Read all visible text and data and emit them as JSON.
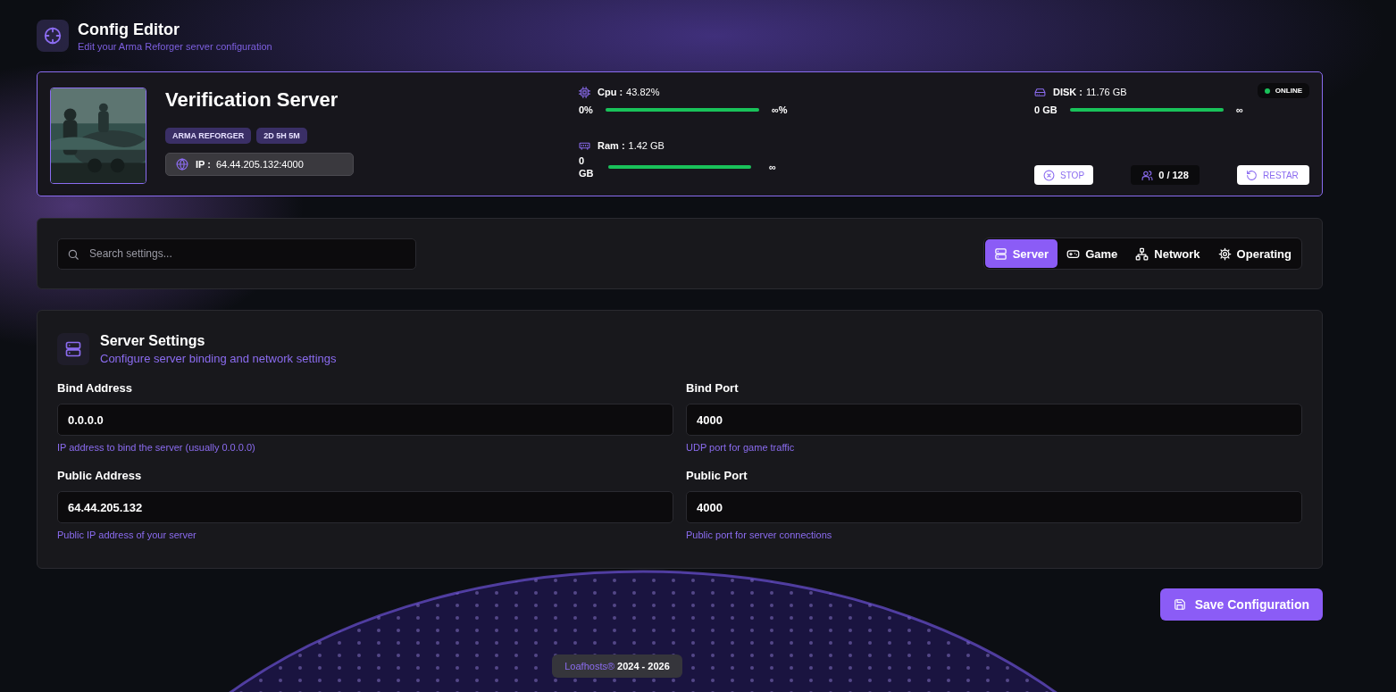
{
  "header": {
    "title": "Config Editor",
    "subtitle": "Edit your Arma Reforger server configuration"
  },
  "server": {
    "image": {
      "kind": "picture"
    },
    "name": "Verification Server",
    "badges": [
      "ARMA REFORGER",
      "2D 5H 5M"
    ],
    "ip_label": "IP :",
    "ip": "64.44.205.132:4000",
    "metrics": [
      {
        "kind": "cpu",
        "label": "Cpu :",
        "value": "43.82%",
        "min": "0%",
        "max": "∞%",
        "level": 1
      },
      {
        "kind": "ram",
        "label": "Ram :",
        "value": "1.42 GB",
        "min": "0 GB",
        "max": "∞",
        "level": 1
      },
      {
        "kind": "disk",
        "label": "DISK :",
        "value": "11.76 GB",
        "min": "0 GB",
        "max": "∞",
        "level": 1
      }
    ],
    "status": {
      "label": "ONLINE",
      "online": true
    },
    "actions": [
      {
        "kind": "stop",
        "label": "STOP"
      },
      {
        "kind": "players",
        "label": "0 / 128"
      },
      {
        "kind": "restart",
        "label": "RESTAR"
      }
    ]
  },
  "filters": {
    "search": {
      "placeholder": "Search settings..."
    },
    "tabs": [
      {
        "kind": "server",
        "label": "Server",
        "selected": true
      },
      {
        "kind": "game",
        "label": "Game",
        "selected": false
      },
      {
        "kind": "network",
        "label": "Network",
        "selected": false
      },
      {
        "kind": "gear",
        "label": "Operating",
        "selected": false
      }
    ]
  },
  "section": {
    "title": "Server Settings",
    "subtitle": "Configure server binding and network settings",
    "fields": [
      {
        "label": "Bind Address",
        "value": "0.0.0.0",
        "hint": "IP address to bind the server (usually 0.0.0.0)"
      },
      {
        "label": "Bind Port",
        "value": "4000",
        "hint": "UDP port for game traffic"
      },
      {
        "label": "Public Address",
        "value": "64.44.205.132",
        "hint": "Public IP address of your server"
      },
      {
        "label": "Public Port",
        "value": "4000",
        "hint": "Public port for server connections"
      }
    ]
  },
  "save_button": "Save Configuration",
  "footer": {
    "brand": "Loafhosts®",
    "years": "2024 - 2026"
  }
}
